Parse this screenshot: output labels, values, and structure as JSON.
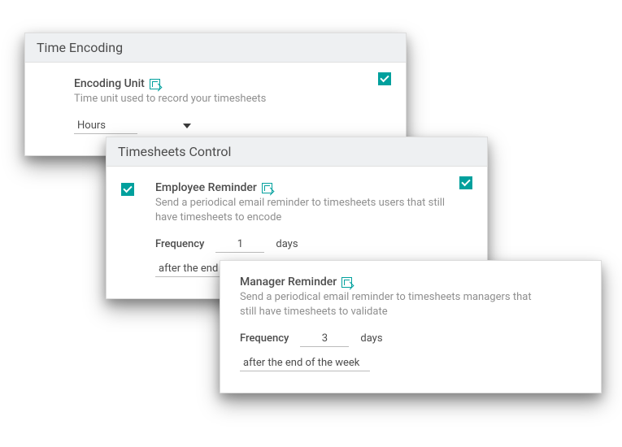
{
  "panels": {
    "time_encoding": {
      "heading": "Time Encoding",
      "setting": {
        "title": "Encoding Unit",
        "desc": "Time unit used to record your timesheets",
        "value": "Hours"
      }
    },
    "timesheets_control": {
      "heading": "Timesheets Control",
      "setting": {
        "title": "Employee Reminder",
        "desc": "Send a periodical email reminder to timesheets users that still have timesheets to encode",
        "freq_label": "Frequency",
        "freq_value": "1",
        "freq_unit": "days",
        "timing_value": "after the end of the week"
      }
    },
    "manager_reminder": {
      "setting": {
        "title": "Manager Reminder",
        "desc": "Send a periodical email reminder to timesheets managers that still have timesheets to validate",
        "freq_label": "Frequency",
        "freq_value": "3",
        "freq_unit": "days",
        "timing_value": "after the end of the week"
      }
    }
  }
}
